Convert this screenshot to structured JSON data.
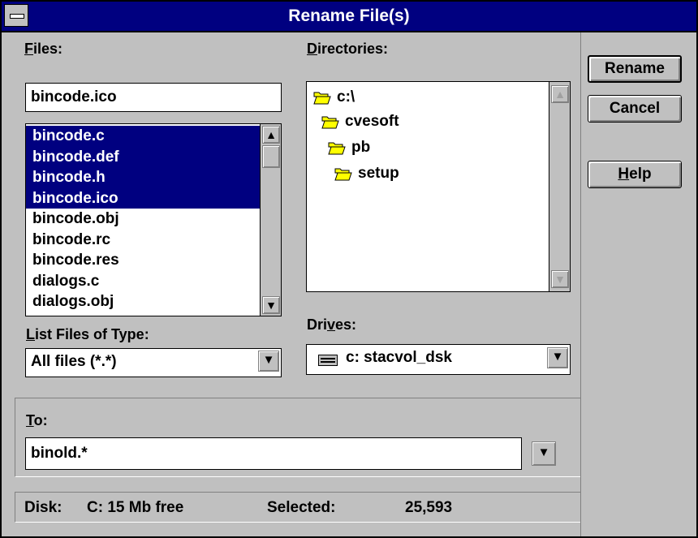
{
  "window": {
    "title": "Rename File(s)"
  },
  "files": {
    "label_accel": "F",
    "label_rest": "iles:",
    "filename_value": "bincode.ico",
    "items": [
      {
        "name": "bincode.c",
        "selected": true
      },
      {
        "name": "bincode.def",
        "selected": true
      },
      {
        "name": "bincode.h",
        "selected": true
      },
      {
        "name": "bincode.ico",
        "selected": true
      },
      {
        "name": "bincode.obj",
        "selected": false
      },
      {
        "name": "bincode.rc",
        "selected": false
      },
      {
        "name": "bincode.res",
        "selected": false
      },
      {
        "name": "dialogs.c",
        "selected": false
      },
      {
        "name": "dialogs.obj",
        "selected": false
      }
    ]
  },
  "directories": {
    "label_accel": "D",
    "label_rest": "irectories:",
    "items": [
      {
        "name": "c:\\",
        "icon": "open-folder-icon"
      },
      {
        "name": "cvesoft",
        "icon": "open-folder-icon"
      },
      {
        "name": "pb",
        "icon": "open-folder-icon"
      },
      {
        "name": "setup",
        "icon": "open-folder-icon"
      }
    ]
  },
  "file_type": {
    "label_accel": "L",
    "label_rest": "ist Files of Type:",
    "value": "All files (*.*)"
  },
  "drives": {
    "label_pre": "Dri",
    "label_accel": "v",
    "label_post": "es:",
    "value": "c:  stacvol_dsk",
    "icon": "drive-icon"
  },
  "to": {
    "label_accel": "T",
    "label_rest": "o:",
    "value": "binold.*"
  },
  "buttons": {
    "rename": "Rename",
    "cancel": "Cancel",
    "help_accel": "H",
    "help_rest": "elp"
  },
  "status": {
    "disk_label": "Disk:",
    "disk_value": "C: 15 Mb free",
    "selected_label": "Selected:",
    "selected_value": "25,593"
  },
  "colors": {
    "title_bar": "#000080",
    "selection": "#000080",
    "dialog_face": "#c0c0c0",
    "folder": "#ffff00"
  }
}
